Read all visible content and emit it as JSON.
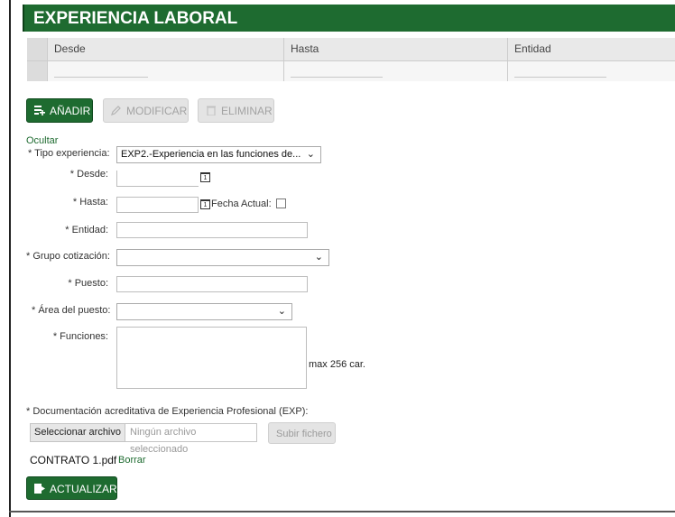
{
  "section": {
    "title": "EXPERIENCIA LABORAL"
  },
  "table": {
    "columns": [
      "Desde",
      "Hasta",
      "Entidad"
    ],
    "rows": [
      [
        "",
        "",
        ""
      ]
    ]
  },
  "toolbar": {
    "add_label": "AÑADIR",
    "modify_label": "MODIFICAR",
    "delete_label": "ELIMINAR"
  },
  "toggle": {
    "label": "Ocultar"
  },
  "form": {
    "tipo_experiencia": {
      "label": "* Tipo experiencia:",
      "value": "EXP2.-Experiencia en las funciones de..."
    },
    "desde": {
      "label": "* Desde:",
      "value": ""
    },
    "hasta": {
      "label": "* Hasta:",
      "value": ""
    },
    "fecha_actual": {
      "label": "Fecha Actual:",
      "checked": false
    },
    "entidad": {
      "label": "* Entidad:",
      "value": ""
    },
    "grupo_cotizacion": {
      "label": "* Grupo cotización:",
      "value": ""
    },
    "puesto": {
      "label": "* Puesto:",
      "value": ""
    },
    "area_puesto": {
      "label": "* Área del puesto:",
      "value": ""
    },
    "funciones": {
      "label": "* Funciones:",
      "value": "",
      "hint": "max 256 car."
    }
  },
  "documentation": {
    "label": "* Documentación acreditativa de Experiencia Profesional (EXP):",
    "select_button": "Seleccionar archivo",
    "no_file": "Ningún archivo seleccionado",
    "upload_button": "Subir fichero",
    "file_name": "CONTRATO 1.pdf",
    "delete_link": "Borrar"
  },
  "footer": {
    "update_label": "ACTUALIZAR"
  },
  "colors": {
    "brand_green": "#1e6b30",
    "disabled_gray": "#e4e4e4"
  },
  "icons": [
    "add-list-icon",
    "edit-icon",
    "trash-icon",
    "calendar-icon",
    "chevron-down-icon",
    "save-icon"
  ]
}
